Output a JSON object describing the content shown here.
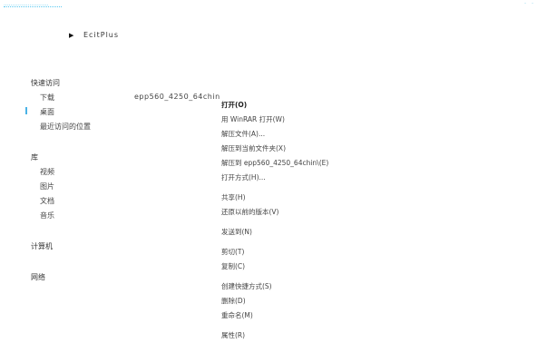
{
  "window": {
    "title": "..........................",
    "controls": [
      "-",
      "-"
    ]
  },
  "breadcrumb": {
    "label": "EcitPlus"
  },
  "file": {
    "name": "epp560_4250_64chin"
  },
  "sidebar": {
    "quick_access": {
      "header": "快速访问",
      "items": [
        {
          "label": "下载"
        },
        {
          "label": "桌面"
        },
        {
          "label": "最近访问的位置"
        }
      ]
    },
    "library": {
      "header": "库",
      "items": [
        {
          "label": "视频"
        },
        {
          "label": "图片"
        },
        {
          "label": "文档"
        },
        {
          "label": "音乐"
        }
      ]
    },
    "computer": {
      "header": "计算机"
    },
    "network": {
      "header": "网络"
    }
  },
  "context_menu": {
    "items": [
      {
        "label": "打开(O)",
        "bold": true
      },
      {
        "label": "用 WinRAR 打开(W)"
      },
      {
        "label": "解压文件(A)..."
      },
      {
        "label": "解压到当前文件夹(X)"
      },
      {
        "label": "解压到 epp560_4250_64chin\\(E)"
      },
      {
        "label": "打开方式(H)..."
      },
      {
        "label": "共享(H)"
      },
      {
        "label": "还原以前的版本(V)"
      },
      {
        "label": "发送到(N)"
      },
      {
        "label": "剪切(T)"
      },
      {
        "label": "复制(C)"
      },
      {
        "label": "创建快捷方式(S)"
      },
      {
        "label": "删除(D)"
      },
      {
        "label": "重命名(M)"
      },
      {
        "label": "属性(R)"
      }
    ]
  }
}
